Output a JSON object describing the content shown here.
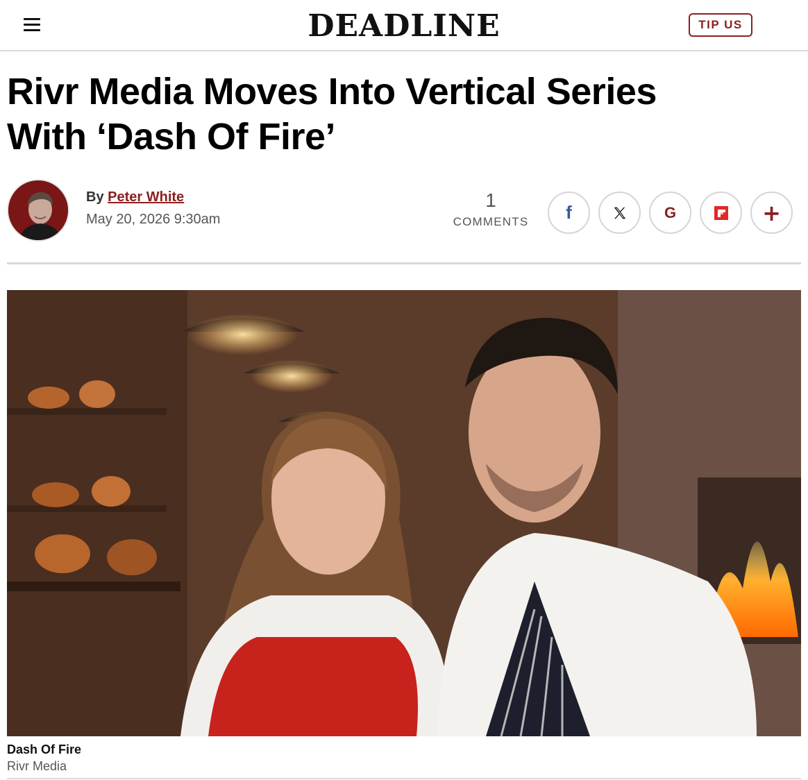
{
  "header": {
    "logo": "DEADLINE",
    "tip_label": "TIP US"
  },
  "article": {
    "headline_line1": "Rivr Media Moves Into Vertical Series",
    "headline_line2": "With ‘Dash Of Fire’",
    "by_label": "By",
    "author": "Peter White",
    "date": "May 20, 2026 9:30am",
    "comments_count": "1",
    "comments_label": "COMMENTS"
  },
  "share": {
    "icons": [
      "facebook-icon",
      "x-icon",
      "google-icon",
      "flipboard-icon",
      "plus-icon"
    ],
    "facebook_glyph": "f",
    "google_glyph": "G",
    "plus_glyph": "+"
  },
  "hero": {
    "caption_title": "Dash Of Fire",
    "caption_credit": "Rivr Media"
  },
  "colors": {
    "brand_red": "#8b1f1f",
    "facebook_blue": "#3b5998",
    "flipboard_red": "#e12828"
  }
}
